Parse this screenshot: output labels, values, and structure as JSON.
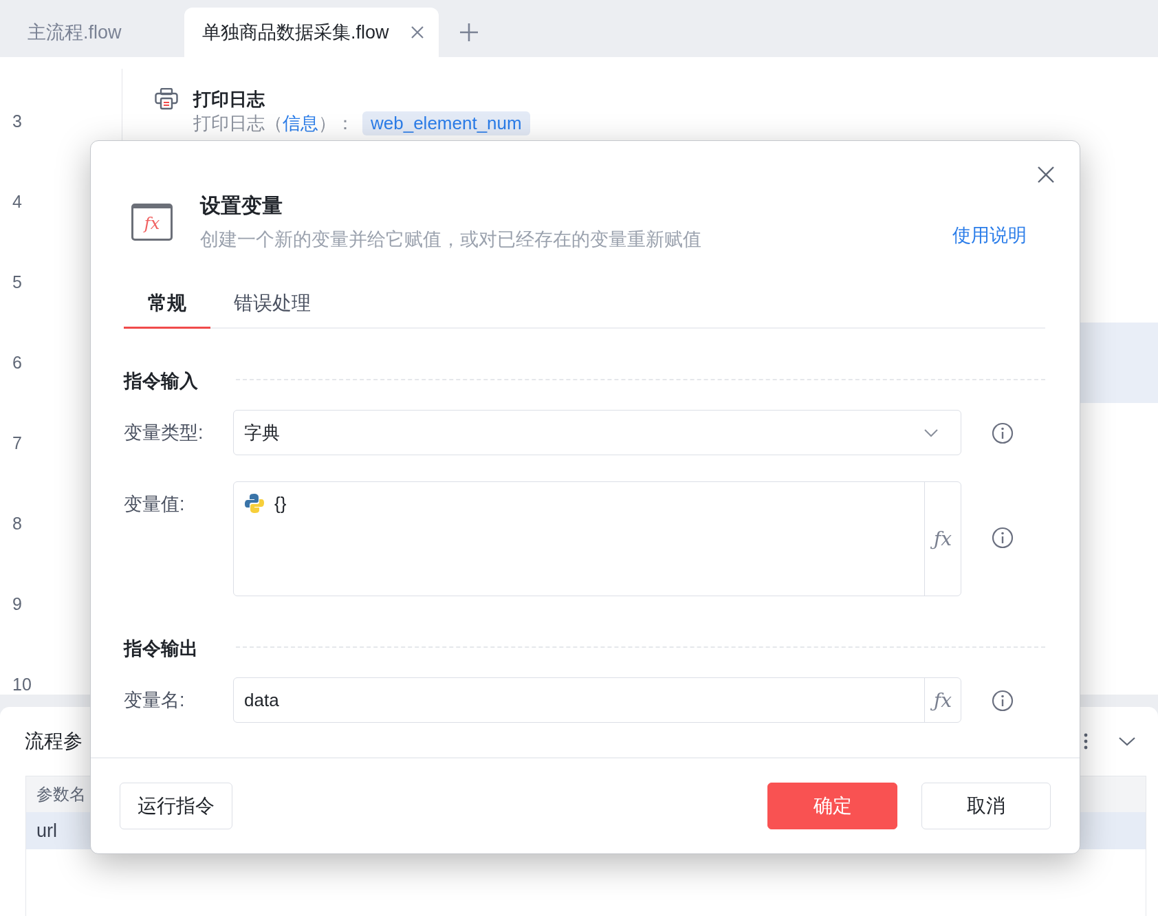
{
  "tabs": [
    {
      "label": "主流程.flow",
      "selected": false,
      "closable": false
    },
    {
      "label": "单独商品数据采集.flow",
      "selected": true,
      "closable": true
    }
  ],
  "editor": {
    "lines": [
      {
        "number": "3",
        "selected": false,
        "step": {
          "title": "打印日志",
          "text_before": "打印日志（",
          "link": "信息",
          "text_after": "）：",
          "variable": "web_element_num"
        }
      },
      {
        "number": "4",
        "selected": false
      },
      {
        "number": "5",
        "selected": false
      },
      {
        "number": "6",
        "selected": true
      },
      {
        "number": "7",
        "selected": false
      },
      {
        "number": "8",
        "selected": false
      },
      {
        "number": "9",
        "selected": false
      },
      {
        "number": "10",
        "selected": false
      }
    ]
  },
  "bottom_panel": {
    "title": "流程参",
    "table": {
      "columns": [
        "参数名"
      ],
      "rows": [
        {
          "cells": [
            "url"
          ],
          "selected": true
        }
      ]
    }
  },
  "dialog": {
    "icon_text": "fx",
    "title": "设置变量",
    "description": "创建一个新的变量并给它赋值，或对已经存在的变量重新赋值",
    "help_link": "使用说明",
    "tabs": [
      {
        "label": "常规",
        "selected": true
      },
      {
        "label": "错误处理",
        "selected": false
      }
    ],
    "sections": [
      {
        "title": "指令输入",
        "fields": [
          {
            "kind": "select",
            "label": "变量类型:",
            "value": "字典"
          },
          {
            "kind": "code",
            "label": "变量值:",
            "value": "{}",
            "formula_button": "ƒx"
          }
        ]
      },
      {
        "title": "指令输出",
        "fields": [
          {
            "kind": "input",
            "label": "变量名:",
            "value": "data",
            "formula_button": "ƒx"
          }
        ]
      }
    ],
    "buttons": [
      {
        "label": "运行指令",
        "kind": "secondary"
      },
      {
        "label": "确定",
        "kind": "primary"
      },
      {
        "label": "取消",
        "kind": "secondary"
      }
    ]
  }
}
